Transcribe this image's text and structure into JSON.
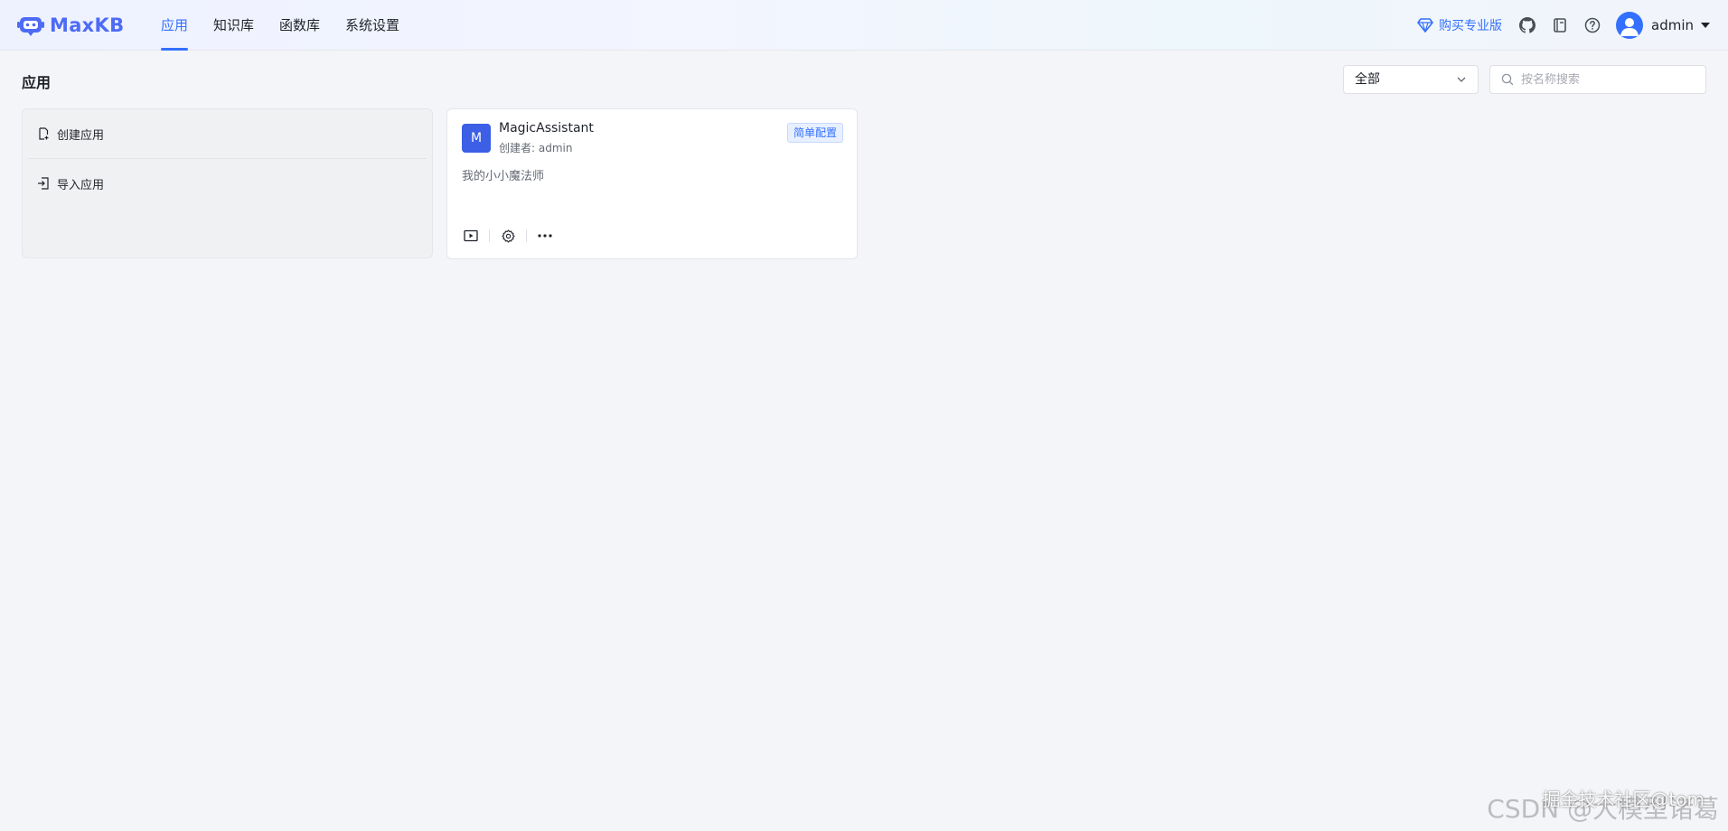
{
  "header": {
    "logo_text": "MaxKB",
    "nav": [
      {
        "label": "应用",
        "active": true
      },
      {
        "label": "知识库",
        "active": false
      },
      {
        "label": "函数库",
        "active": false
      },
      {
        "label": "系统设置",
        "active": false
      }
    ],
    "buy_pro_label": "购买专业版",
    "username": "admin",
    "accent_color": "#3370ff"
  },
  "page": {
    "title": "应用",
    "filter": {
      "selected": "全部"
    },
    "search": {
      "placeholder": "按名称搜索",
      "value": ""
    }
  },
  "create_card": {
    "create_label": "创建应用",
    "import_label": "导入应用"
  },
  "apps": [
    {
      "avatar_letter": "M",
      "name": "MagicAssistant",
      "creator": "创建者: admin",
      "tag": "简单配置",
      "description": "我的小小魔法师"
    }
  ],
  "watermark": {
    "line1": "CSDN @大模型诸葛",
    "line2": "掘金技术社区@tom"
  }
}
